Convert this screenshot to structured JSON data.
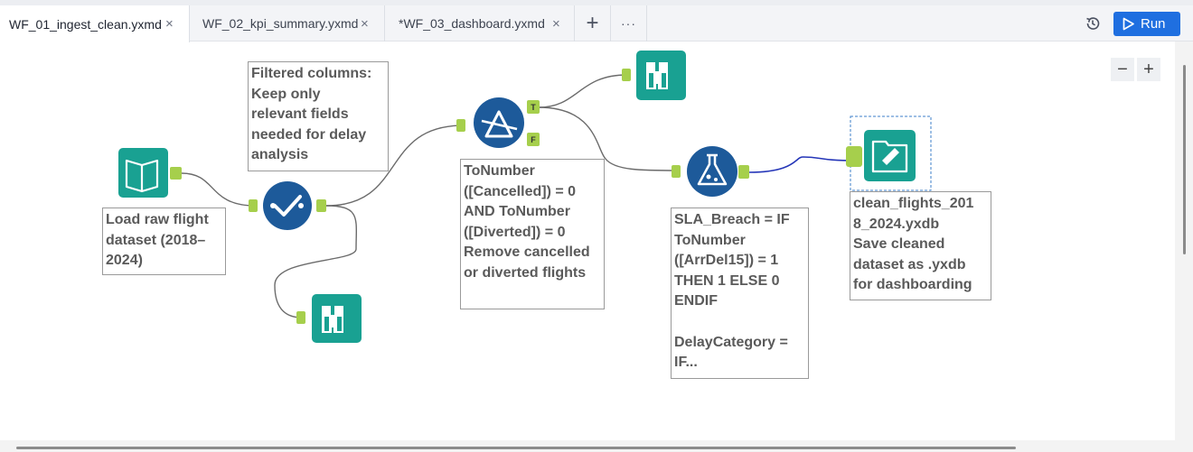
{
  "tabs": [
    {
      "label": "WF_01_ingest_clean.yxmd",
      "close": "×",
      "active": true
    },
    {
      "label": "WF_02_kpi_summary.yxmd",
      "close": "×",
      "active": false
    },
    {
      "label": "*WF_03_dashboard.yxmd",
      "close": "×",
      "active": false
    }
  ],
  "toolbar": {
    "add": "+",
    "more": "···",
    "run_label": "Run"
  },
  "zoom": {
    "out": "−",
    "in": "+"
  },
  "annotations": {
    "select": "Filtered columns:\nKeep only\nrelevant fields\nneeded for delay\nanalysis",
    "input": "Load raw flight\ndataset (2018–\n2024)",
    "filter": "ToNumber\n([Cancelled]) = 0\nAND ToNumber\n([Diverted]) = 0\nRemove cancelled\nor diverted flights",
    "formula": "SLA_Breach = IF\nToNumber\n([ArrDel15]) = 1\nTHEN 1 ELSE 0\nENDIF\n\nDelayCategory =\nIF...",
    "output": "clean_flights_201\n8_2024.yxdb\nSave cleaned\ndataset as .yxdb\nfor dashboarding"
  },
  "anchors": {
    "true": "T",
    "false": "F"
  },
  "colors": {
    "tool_blue": "#1d5a9a",
    "tool_green": "#19a192",
    "anchor_green": "#a6cf4c",
    "run_blue": "#1f6fe0",
    "selected_connection": "#2536b8"
  }
}
